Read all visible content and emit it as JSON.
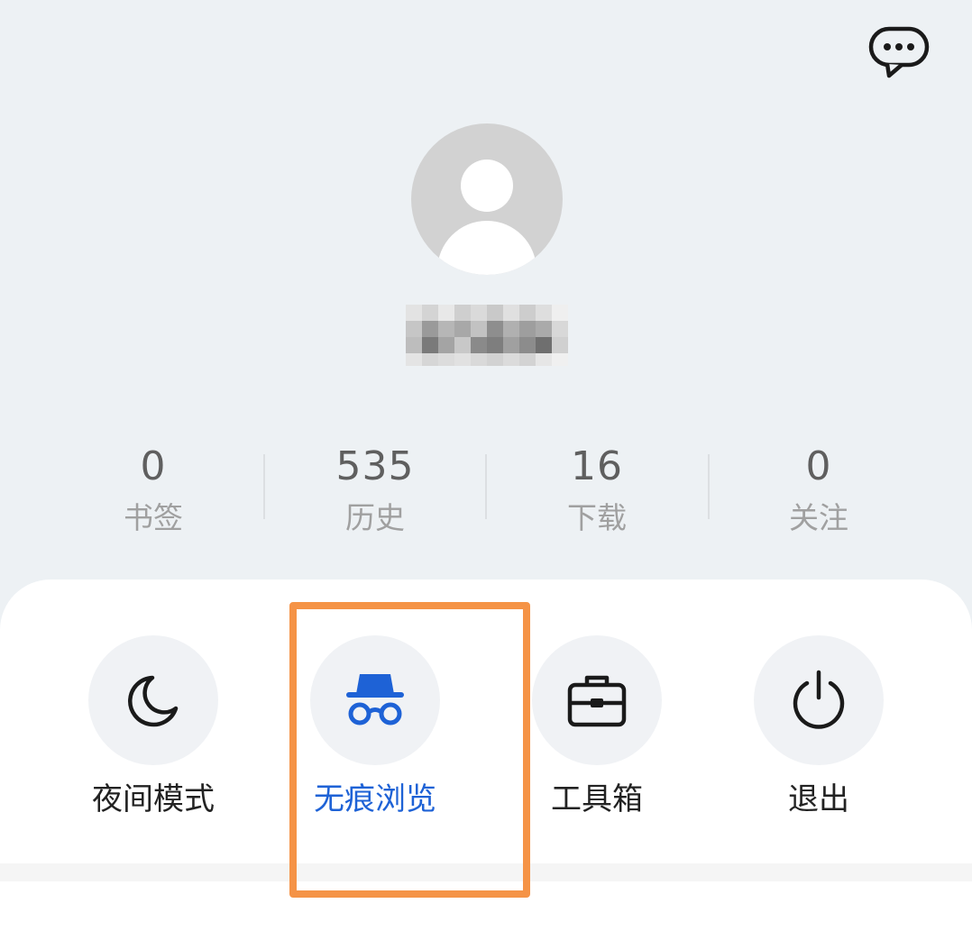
{
  "header": {
    "chat_icon": "chat-bubble-icon"
  },
  "profile": {
    "avatar_icon": "user-avatar-icon",
    "username_blurred": true
  },
  "stats": [
    {
      "value": "0",
      "label": "书签"
    },
    {
      "value": "535",
      "label": "历史"
    },
    {
      "value": "16",
      "label": "下载"
    },
    {
      "value": "0",
      "label": "关注"
    }
  ],
  "tools": [
    {
      "label": "夜间模式",
      "icon": "moon-icon"
    },
    {
      "label": "无痕浏览",
      "icon": "incognito-icon",
      "active": true
    },
    {
      "label": "工具箱",
      "icon": "toolbox-icon"
    },
    {
      "label": "退出",
      "icon": "power-icon"
    }
  ],
  "colors": {
    "background": "#edf1f4",
    "accent": "#1e62d6",
    "highlight_border": "#f59346"
  }
}
